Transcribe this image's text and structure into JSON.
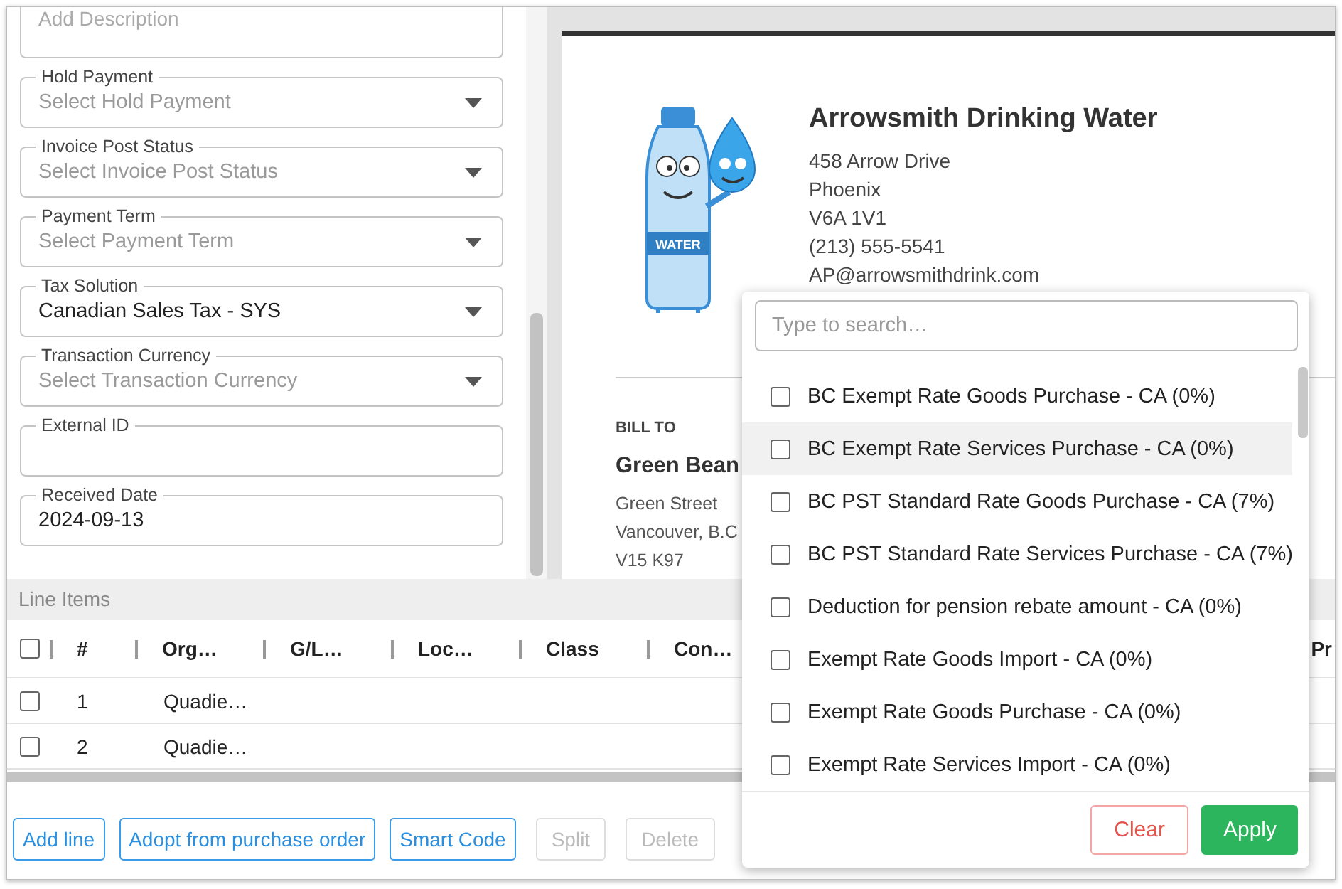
{
  "form": {
    "fields": [
      {
        "kind": "textarea",
        "placeholder": "Add Description"
      },
      {
        "kind": "select",
        "label": "Hold Payment",
        "placeholder": "Select Hold Payment"
      },
      {
        "kind": "select",
        "label": "Invoice Post Status",
        "placeholder": "Select Invoice Post Status"
      },
      {
        "kind": "select",
        "label": "Payment Term",
        "placeholder": "Select Payment Term"
      },
      {
        "kind": "select",
        "label": "Tax Solution",
        "value": "Canadian Sales Tax - SYS"
      },
      {
        "kind": "select",
        "label": "Transaction Currency",
        "placeholder": "Select Transaction Currency"
      },
      {
        "kind": "text",
        "label": "External ID"
      },
      {
        "kind": "text",
        "label": "Received Date",
        "value": "2024-09-13"
      }
    ]
  },
  "document": {
    "logo_label": "WATER",
    "vendor": {
      "name": "Arrowsmith Drinking Water",
      "lines": [
        "458 Arrow Drive",
        "Phoenix",
        "V6A 1V1",
        "(213) 555-5541",
        "AP@arrowsmithdrink.com"
      ]
    },
    "bill_to": {
      "heading": "BILL TO",
      "name": "Green Bean",
      "lines": [
        "Green Street",
        "Vancouver, B.C",
        "V15 K97"
      ]
    }
  },
  "line_items": {
    "title": "Line Items",
    "all_checked": false,
    "columns": [
      "#",
      "Org…",
      "G/L…",
      "Loc…",
      "Class",
      "Con…",
      "Pr"
    ],
    "rows": [
      {
        "checked": false,
        "cells": [
          "1",
          "Quadie…"
        ]
      },
      {
        "checked": false,
        "cells": [
          "2",
          "Quadie…"
        ]
      }
    ]
  },
  "buttons": [
    {
      "label": "Add line",
      "disabled": false
    },
    {
      "label": "Adopt from purchase order",
      "disabled": false
    },
    {
      "label": "Smart Code",
      "disabled": false
    },
    {
      "label": "Split",
      "disabled": true
    },
    {
      "label": "Delete",
      "disabled": true
    }
  ],
  "tax_picker": {
    "search": {
      "placeholder": "Type to search…"
    },
    "options": [
      {
        "label": "BC Exempt Rate Goods Purchase - CA (0%)",
        "checked": false,
        "highlighted": false
      },
      {
        "label": "BC Exempt Rate Services Purchase - CA (0%)",
        "checked": false,
        "highlighted": true
      },
      {
        "label": "BC PST Standard Rate Goods Purchase - CA (7%)",
        "checked": false,
        "highlighted": false
      },
      {
        "label": "BC PST Standard Rate Services Purchase - CA (7%)",
        "checked": false,
        "highlighted": false
      },
      {
        "label": "Deduction for pension rebate amount - CA (0%)",
        "checked": false,
        "highlighted": false
      },
      {
        "label": "Exempt Rate Goods Import - CA (0%)",
        "checked": false,
        "highlighted": false
      },
      {
        "label": "Exempt Rate Goods Purchase - CA (0%)",
        "checked": false,
        "highlighted": false
      },
      {
        "label": "Exempt Rate Services Import - CA (0%)",
        "checked": false,
        "highlighted": false
      }
    ],
    "buttons": [
      {
        "label": "Clear",
        "kind": "secondary"
      },
      {
        "label": "Apply",
        "kind": "primary"
      }
    ]
  }
}
